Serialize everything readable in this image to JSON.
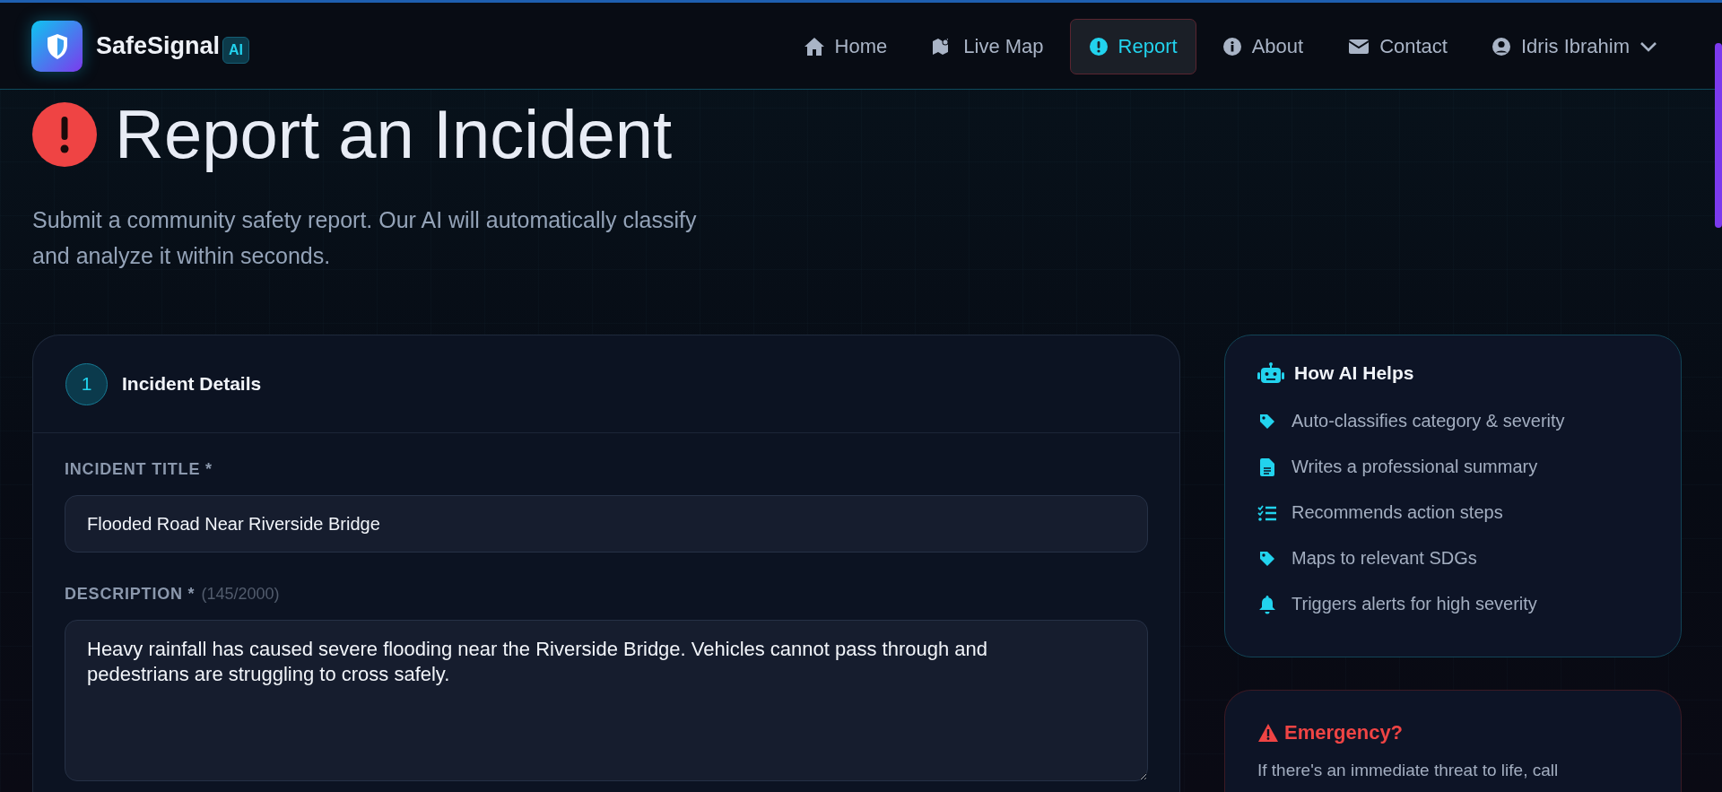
{
  "brand": {
    "name": "SafeSignal",
    "badge": "AI"
  },
  "nav": [
    {
      "label": "Home",
      "kind": "home",
      "selected": false
    },
    {
      "label": "Live Map",
      "kind": "map",
      "selected": false
    },
    {
      "label": "Report",
      "kind": "alert",
      "selected": true
    },
    {
      "label": "About",
      "kind": "info",
      "selected": false
    },
    {
      "label": "Contact",
      "kind": "mail",
      "selected": false
    }
  ],
  "user": {
    "name": "Idris Ibrahim"
  },
  "header": {
    "title": "Report an Incident",
    "subtitle": "Submit a community safety report. Our AI will automatically classify and analyze it within seconds."
  },
  "form": {
    "step": "1",
    "title": "Incident Details",
    "fields": [
      {
        "kind": "input",
        "label": "INCIDENT TITLE *",
        "value": "Flooded Road Near Riverside Bridge"
      },
      {
        "kind": "textarea",
        "label": "DESCRIPTION *",
        "counter": "(145/2000)",
        "value": "Heavy rainfall has caused severe flooding near the Riverside Bridge. Vehicles cannot pass through and pedestrians are struggling to cross safely."
      }
    ]
  },
  "ai_help": {
    "title": "How AI Helps",
    "items": [
      {
        "kind": "tag",
        "text": "Auto-classifies category & severity"
      },
      {
        "kind": "file",
        "text": "Writes a professional summary"
      },
      {
        "kind": "list",
        "text": "Recommends action steps"
      },
      {
        "kind": "tag",
        "text": "Maps to relevant SDGs"
      },
      {
        "kind": "bell",
        "text": "Triggers alerts for high severity"
      }
    ]
  },
  "emergency": {
    "title": "Emergency?",
    "text": "If there's an immediate threat to life, call"
  }
}
